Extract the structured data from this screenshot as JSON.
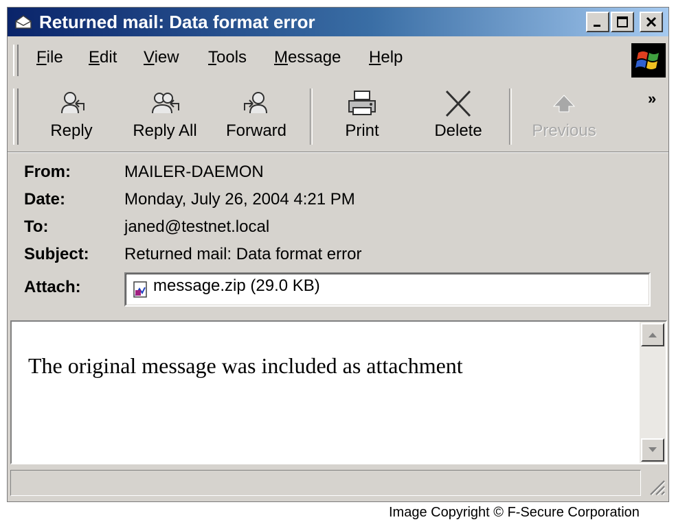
{
  "window": {
    "title": "Returned mail: Data format error"
  },
  "menu": {
    "items": [
      "File",
      "Edit",
      "View",
      "Tools",
      "Message",
      "Help"
    ]
  },
  "toolbar": {
    "reply": "Reply",
    "reply_all": "Reply All",
    "forward": "Forward",
    "print": "Print",
    "delete": "Delete",
    "previous": "Previous",
    "overflow": "»"
  },
  "header": {
    "from_label": "From:",
    "from": "MAILER-DAEMON",
    "date_label": "Date:",
    "date": "Monday, July 26, 2004 4:21 PM",
    "to_label": "To:",
    "to": "janed@testnet.local",
    "subject_label": "Subject:",
    "subject": "Returned mail: Data format error",
    "attach_label": "Attach:",
    "attachment": "message.zip (29.0 KB)"
  },
  "body": {
    "text": "The original message was included as attachment"
  },
  "footer": {
    "copyright": "Image Copyright © F-Secure Corporation"
  },
  "colors": {
    "title_start": "#0a246a",
    "title_end": "#a6caf0",
    "window_face": "#d6d3ce"
  },
  "icons": {
    "title": "envelope-icon",
    "reply": "reply-icon",
    "reply_all": "reply-all-icon",
    "forward": "forward-icon",
    "print": "printer-icon",
    "delete": "delete-x-icon",
    "previous": "up-arrow-icon",
    "attachment": "zip-file-icon"
  }
}
